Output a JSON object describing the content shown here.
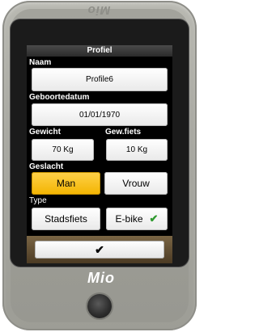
{
  "device": {
    "top_logo": "Mio",
    "brand": "Mio"
  },
  "screen": {
    "title": "Profiel",
    "name": {
      "label": "Naam",
      "value": "Profile6"
    },
    "birthdate": {
      "label": "Geboortedatum",
      "value": "01/01/1970"
    },
    "weight": {
      "label": "Gewicht",
      "value": "70 Kg"
    },
    "bike_weight": {
      "label": "Gew.fiets",
      "value": "10 Kg"
    },
    "gender": {
      "label": "Geslacht",
      "options": [
        "Man",
        "Vrouw"
      ],
      "selected": "Man"
    },
    "type": {
      "label": "Type",
      "options": [
        "Stadsfiets",
        "E-bike"
      ],
      "selected": "E-bike"
    },
    "confirm_icon": "checkmark-icon",
    "colors": {
      "selected": "#f3b400",
      "check": "#2f9a2f",
      "bottom_bar": "#6a5536"
    }
  }
}
